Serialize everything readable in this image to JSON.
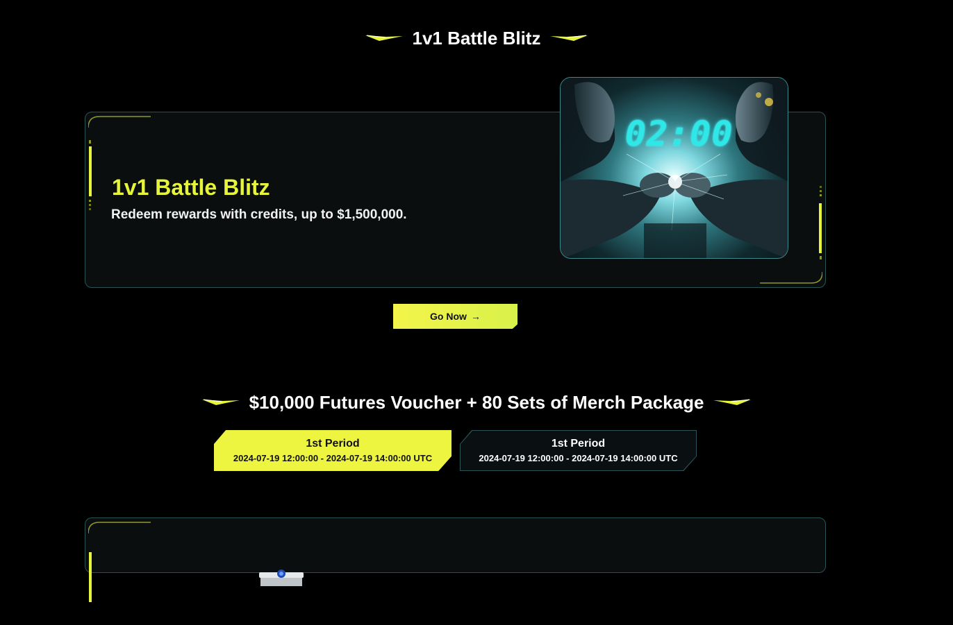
{
  "sections": {
    "battle": {
      "heading": "1v1 Battle Blitz",
      "card_title": "1v1 Battle Blitz",
      "card_subtitle": "Redeem rewards with credits, up to $1,500,000.",
      "hero_timer": "02:00",
      "go_button": "Go Now"
    },
    "voucher": {
      "heading": "$10,000 Futures Voucher + 80 Sets of Merch Package",
      "tabs": [
        {
          "label": "1st Period",
          "dates": "2024-07-19 12:00:00 - 2024-07-19 14:00:00 UTC",
          "active": true
        },
        {
          "label": "1st Period",
          "dates": "2024-07-19 12:00:00 - 2024-07-19 14:00:00 UTC",
          "active": false
        }
      ]
    }
  },
  "colors": {
    "accent": "#edf541",
    "title_accent": "#e6f53a",
    "card_border": "#2a5356",
    "background": "#000000",
    "card_bg": "#0a0e0e"
  },
  "icons": {
    "wing": "lightning-wing-icon",
    "arrow": "arrow-right-icon"
  }
}
